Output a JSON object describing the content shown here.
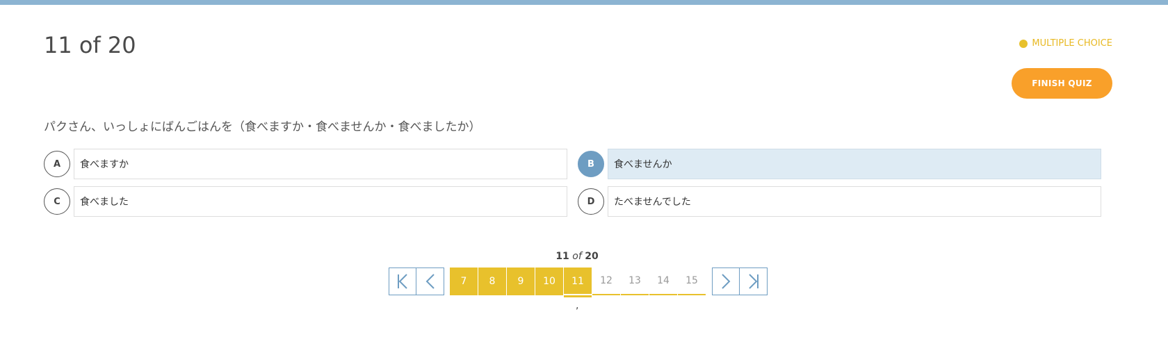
{
  "header": {
    "counter": "11 of 20",
    "question_type": "MULTIPLE CHOICE",
    "finish_label": "FINISH QUIZ"
  },
  "question": {
    "text": "パクさん、いっしょにばんごはんを（食べますか・食べませんか・食べましたか）"
  },
  "answers": [
    {
      "letter": "A",
      "text": "食べますか",
      "selected": false
    },
    {
      "letter": "B",
      "text": "食べませんか",
      "selected": true
    },
    {
      "letter": "C",
      "text": "食べました",
      "selected": false
    },
    {
      "letter": "D",
      "text": "たべませんでした",
      "selected": false
    }
  ],
  "pager": {
    "current": "11",
    "of_word": "of",
    "total": "20",
    "pages": [
      "7",
      "8",
      "9",
      "10",
      "11",
      "12",
      "13",
      "14",
      "15"
    ],
    "answered_pages": [
      "7",
      "8",
      "9",
      "10",
      "11"
    ],
    "trailing_mark": ","
  },
  "colors": {
    "topbar": "#8cb4d2",
    "accent_yellow": "#e8c12c",
    "finish_orange": "#f9a02a",
    "selected_blue": "#6e9dc2",
    "selected_fill": "#deebf4"
  },
  "icons": {
    "first": "first-page-icon",
    "prev": "chevron-left-icon",
    "next": "chevron-right-icon",
    "last": "last-page-icon"
  }
}
